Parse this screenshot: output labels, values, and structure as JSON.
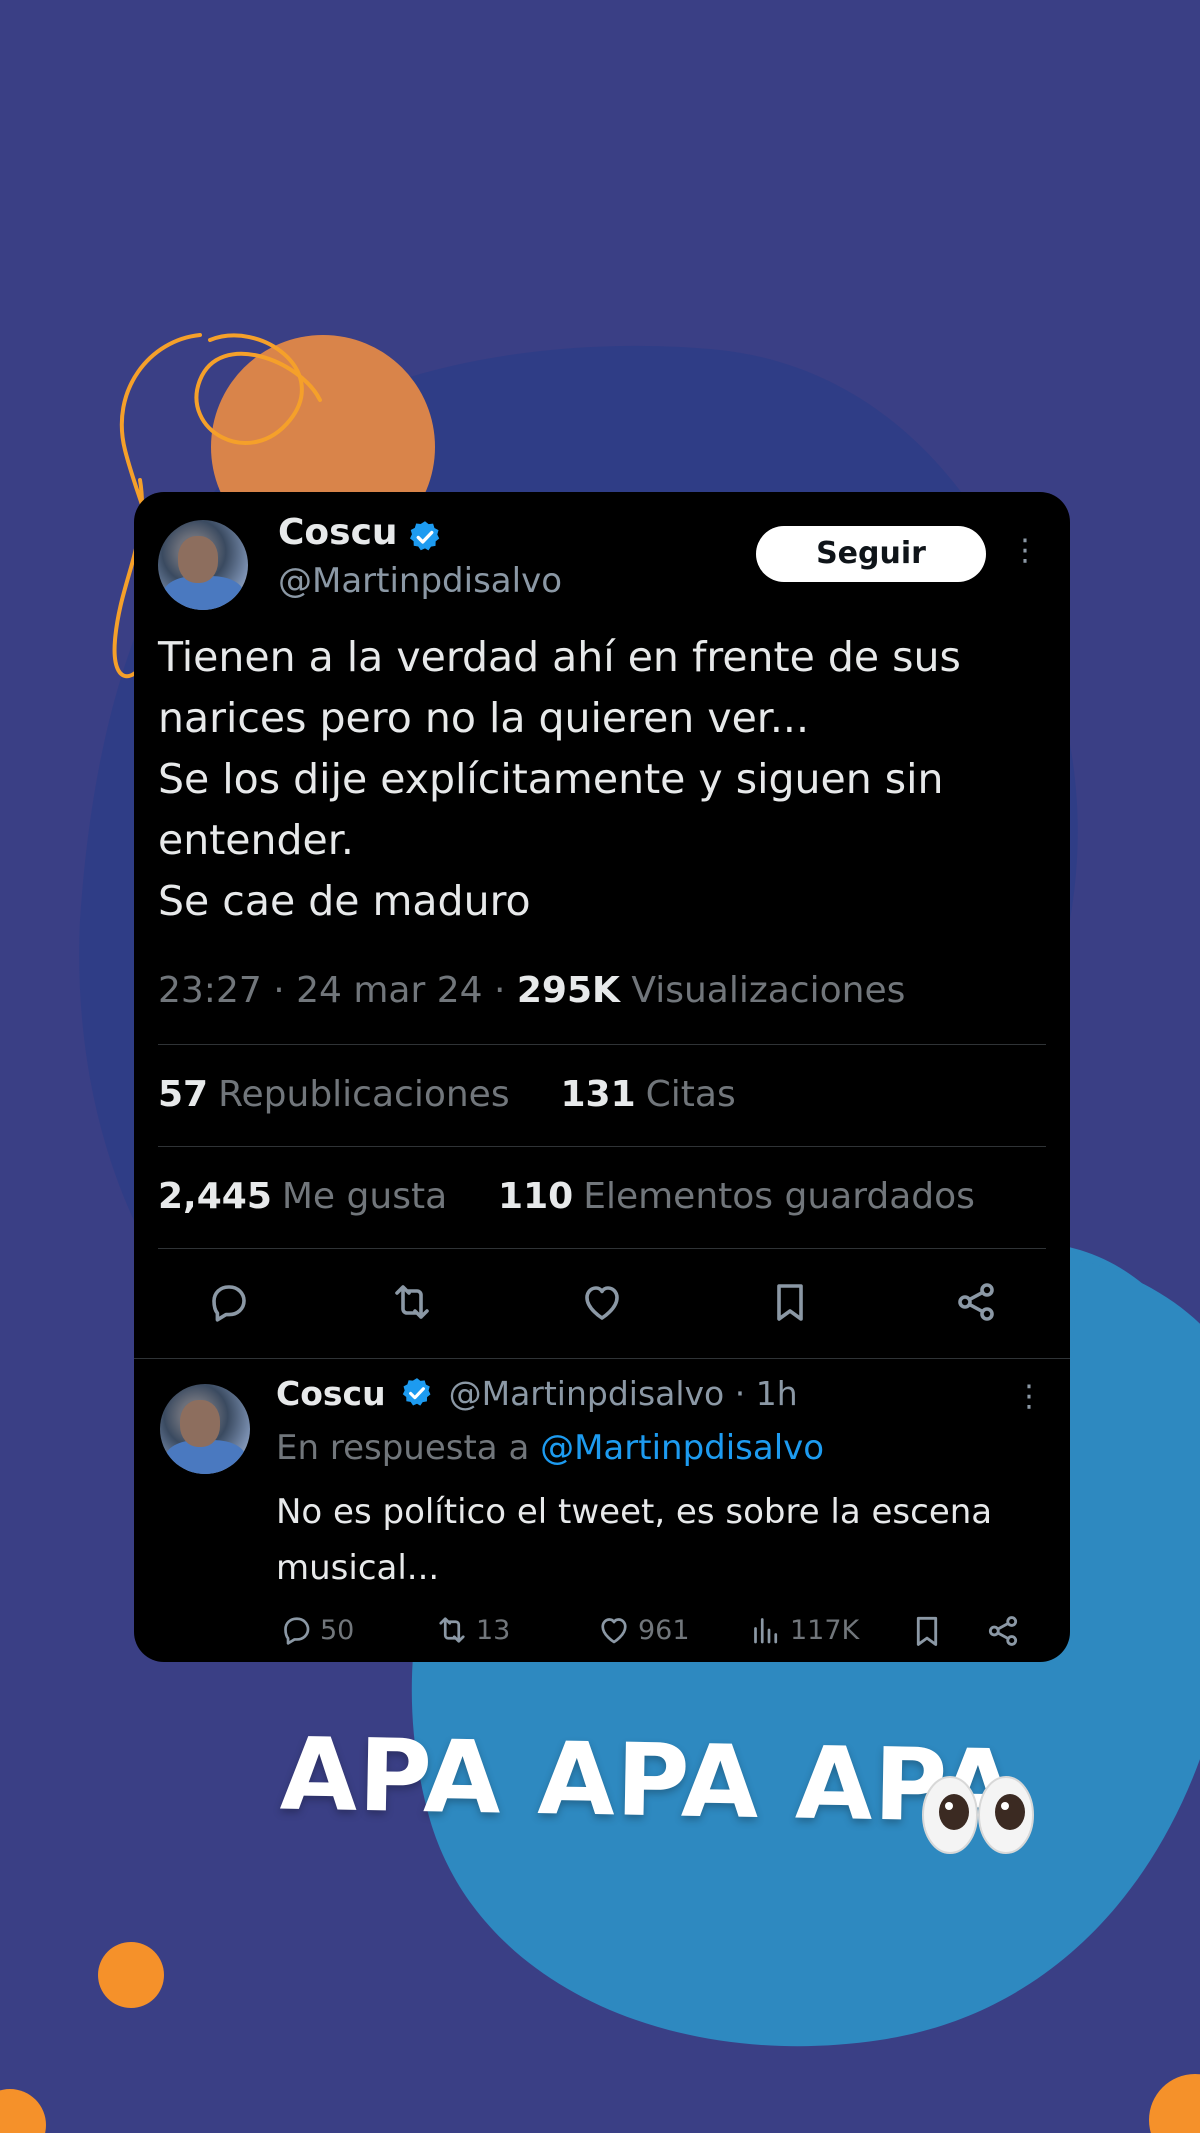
{
  "colors": {
    "background": "#3a3f85",
    "blob_dark": "#2f3d86",
    "blob_light": "#2e89c0",
    "orange": "#f5912a",
    "card": "#000000",
    "link": "#1d9bf0"
  },
  "tweet": {
    "author_name": "Coscu",
    "author_handle": "@Martinpdisalvo",
    "follow_label": "Seguir",
    "more_label": "⋮",
    "text": "Tienen a la verdad ahí en frente de sus\nnarices pero no la quieren ver...\nSe los dije explícitamente y siguen sin\nentender.\nSe cae de maduro",
    "time": "23:27",
    "date": "24 mar 24",
    "views_count": "295K",
    "views_label": "Visualizaciones",
    "reposts_count": "57",
    "reposts_label": "Republicaciones",
    "quotes_count": "131",
    "quotes_label": "Citas",
    "likes_count": "2,445",
    "likes_label": "Me gusta",
    "bookmarks_count": "110",
    "bookmarks_label": "Elementos guardados",
    "actions": [
      "reply-icon",
      "repost-icon",
      "like-icon",
      "bookmark-icon",
      "share-icon"
    ]
  },
  "reply": {
    "author_name": "Coscu",
    "author_handle": "@Martinpdisalvo",
    "separator": "·",
    "time": "1h",
    "more_label": "⋮",
    "in_reply_prefix": "En respuesta a",
    "in_reply_handle": "@Martinpdisalvo",
    "text": "No es político el tweet, es sobre la escena\nmusical...",
    "replies": "50",
    "reposts": "13",
    "likes": "961",
    "views": "117K"
  },
  "caption": "APA APA APA",
  "caption_emoji": "eyes-emoji"
}
